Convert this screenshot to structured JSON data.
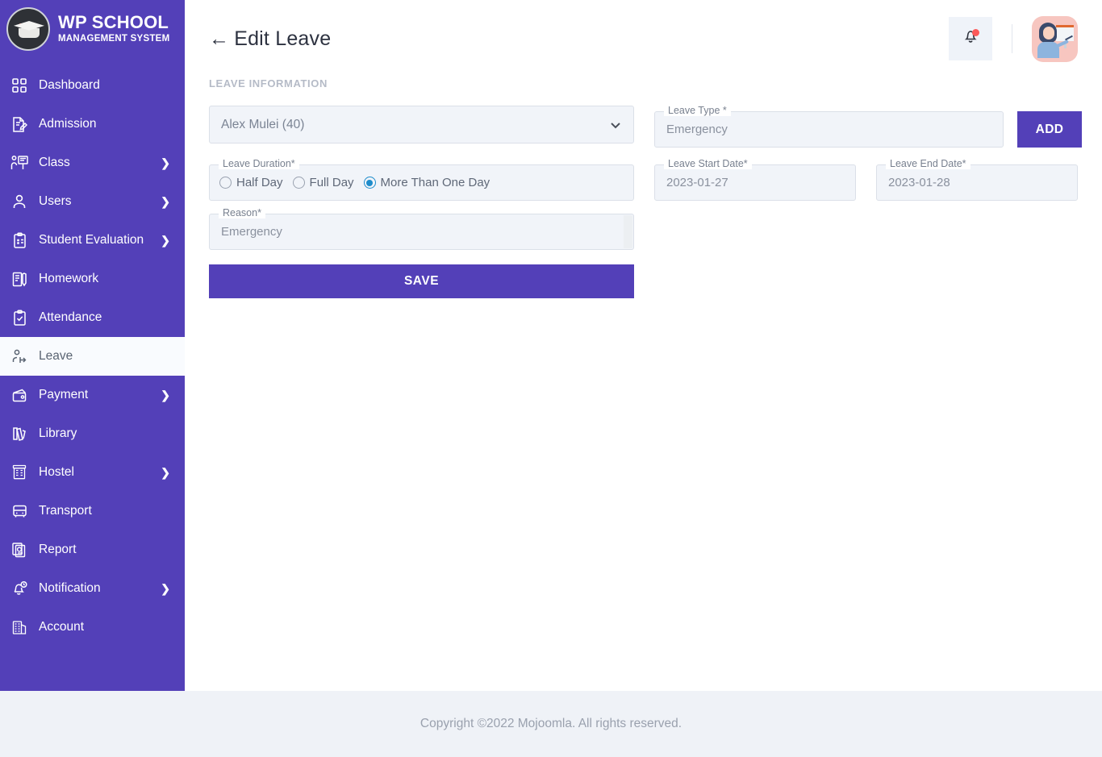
{
  "brand": {
    "title": "WP SCHOOL",
    "subtitle": "MANAGEMENT SYSTEM",
    "logo_icon": "graduation-cap-logo"
  },
  "sidebar": {
    "items": [
      {
        "label": "Dashboard",
        "icon": "grid-icon",
        "expandable": false,
        "active": false
      },
      {
        "label": "Admission",
        "icon": "document-edit-icon",
        "expandable": false,
        "active": false
      },
      {
        "label": "Class",
        "icon": "teacher-board-icon",
        "expandable": true,
        "active": false
      },
      {
        "label": "Users",
        "icon": "user-icon",
        "expandable": true,
        "active": false
      },
      {
        "label": "Student Evaluation",
        "icon": "clipboard-check-icon",
        "expandable": true,
        "active": false
      },
      {
        "label": "Homework",
        "icon": "book-pen-icon",
        "expandable": false,
        "active": false
      },
      {
        "label": "Attendance",
        "icon": "clipboard-tick-icon",
        "expandable": false,
        "active": false
      },
      {
        "label": "Leave",
        "icon": "user-leave-icon",
        "expandable": false,
        "active": true
      },
      {
        "label": "Payment",
        "icon": "wallet-icon",
        "expandable": true,
        "active": false
      },
      {
        "label": "Library",
        "icon": "books-icon",
        "expandable": false,
        "active": false
      },
      {
        "label": "Hostel",
        "icon": "hostel-icon",
        "expandable": true,
        "active": false
      },
      {
        "label": "Transport",
        "icon": "bus-icon",
        "expandable": false,
        "active": false
      },
      {
        "label": "Report",
        "icon": "report-chart-icon",
        "expandable": false,
        "active": false
      },
      {
        "label": "Notification",
        "icon": "bell-clock-icon",
        "expandable": true,
        "active": false
      },
      {
        "label": "Account",
        "icon": "building-icon",
        "expandable": false,
        "active": false
      }
    ],
    "chevron_glyph": "❯",
    "bg_color": "#5340b8",
    "active_bg_color": "#f9fbfe"
  },
  "topbar": {
    "back_arrow": "←",
    "title": "Edit Leave",
    "notification_icon": "bell-icon",
    "has_notification_dot": true,
    "avatar_icon": "teacher-avatar"
  },
  "main": {
    "section_title": "LEAVE INFORMATION",
    "student_select": {
      "value": "Alex Mulei (40)",
      "chevron_icon": "chevron-down-icon"
    },
    "leave_type": {
      "label": "Leave Type *",
      "value": "Emergency"
    },
    "add_button": {
      "label": "ADD",
      "color": "#5340b8"
    },
    "leave_duration": {
      "label": "Leave Duration*",
      "options": [
        {
          "label": "Half Day",
          "selected": false
        },
        {
          "label": "Full Day",
          "selected": false
        },
        {
          "label": "More Than One Day",
          "selected": true
        }
      ],
      "selected_color": "#1e8ccb"
    },
    "leave_start_date": {
      "label": "Leave Start Date*",
      "value": "2023-01-27"
    },
    "leave_end_date": {
      "label": "Leave End Date*",
      "value": "2023-01-28"
    },
    "reason": {
      "label": "Reason*",
      "value": "Emergency"
    },
    "save_button": {
      "label": "SAVE",
      "color": "#5340b8"
    }
  },
  "footer": {
    "text": "Copyright ©2022 Mojoomla. All rights reserved."
  }
}
